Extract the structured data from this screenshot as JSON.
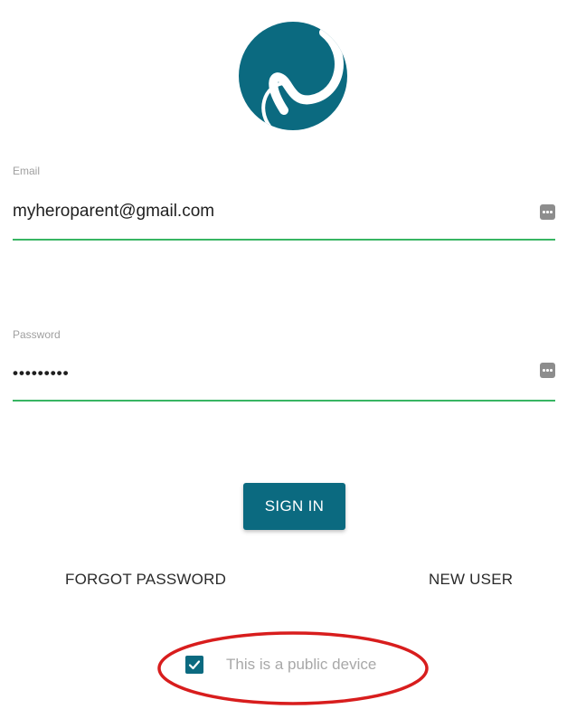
{
  "logo": {
    "icon": "hero-logo-icon",
    "color": "#0b6a80"
  },
  "email": {
    "label": "Email",
    "value": "myheroparent@gmail.com",
    "underline_color": "#38b563"
  },
  "password": {
    "label": "Password",
    "value": "•••••••••",
    "underline_color": "#38b563"
  },
  "signin_label": "SIGN IN",
  "forgot_label": "FORGOT PASSWORD",
  "new_user_label": "NEW USER",
  "public_device": {
    "label": "This is a public device",
    "checked": true
  },
  "colors": {
    "accent": "#0b6a80",
    "annotation": "#d81d1d"
  }
}
